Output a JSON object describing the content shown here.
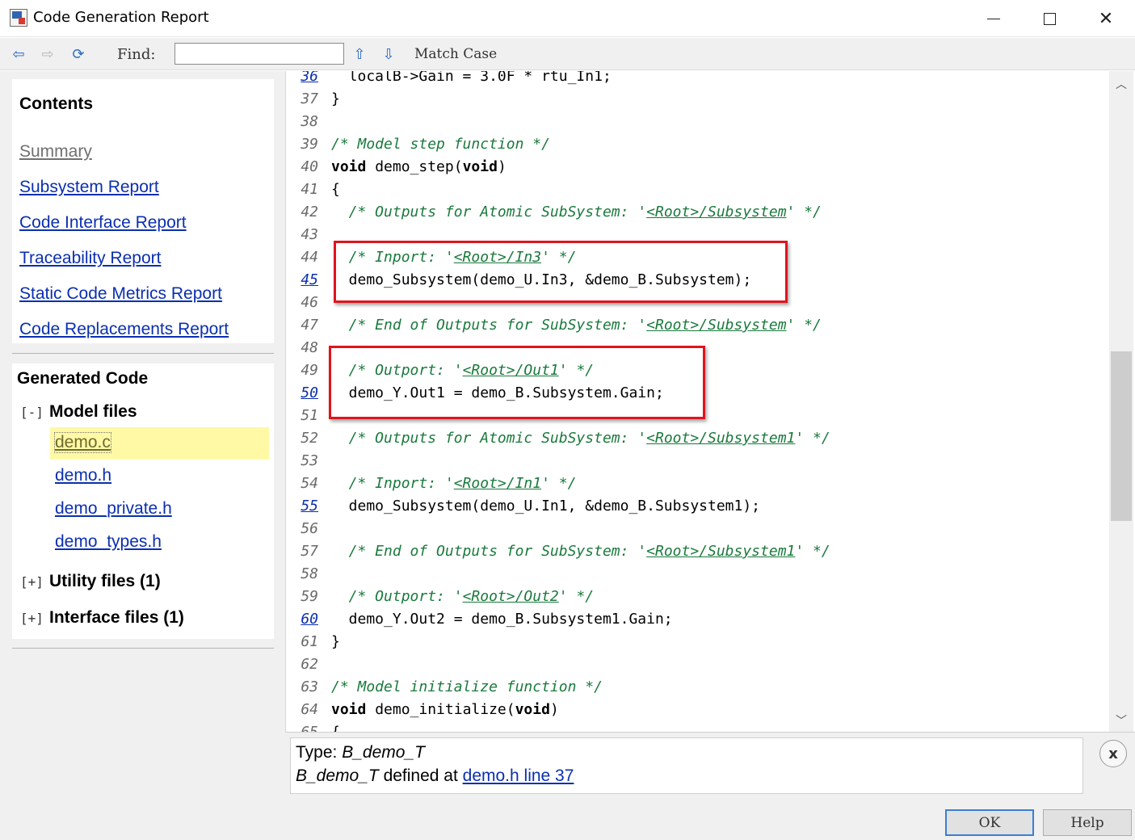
{
  "window": {
    "title": "Code Generation Report"
  },
  "toolbar": {
    "find_label": "Find:",
    "find_value": "",
    "match_case_label": "Match Case"
  },
  "contents": {
    "heading": "Contents",
    "links": [
      {
        "label": "Summary",
        "visited": true
      },
      {
        "label": "Subsystem Report"
      },
      {
        "label": "Code Interface Report"
      },
      {
        "label": "Traceability Report"
      },
      {
        "label": "Static Code Metrics Report"
      },
      {
        "label": "Code Replacements Report"
      }
    ]
  },
  "generated_code": {
    "heading": "Generated Code",
    "model_files": {
      "toggle": "[-]",
      "label": "Model files",
      "files": [
        "demo.c",
        "demo.h",
        "demo_private.h",
        "demo_types.h"
      ],
      "selected": "demo.c"
    },
    "utility_files": {
      "toggle": "[+]",
      "label": "Utility files (1)"
    },
    "interface_files": {
      "toggle": "[+]",
      "label": "Interface files (1)"
    }
  },
  "code": {
    "lines": [
      {
        "n": "36",
        "link": true,
        "parts": [
          [
            "t",
            "  localB->Gain = 3.0F * rtu_In1;"
          ]
        ]
      },
      {
        "n": "37",
        "parts": [
          [
            "t",
            "}"
          ]
        ]
      },
      {
        "n": "38",
        "parts": []
      },
      {
        "n": "39",
        "parts": [
          [
            "c",
            "/* Model step function */"
          ]
        ]
      },
      {
        "n": "40",
        "parts": [
          [
            "k",
            "void"
          ],
          [
            "t",
            " demo_step("
          ],
          [
            "k",
            "void"
          ],
          [
            "t",
            ")"
          ]
        ]
      },
      {
        "n": "41",
        "parts": [
          [
            "t",
            "{"
          ]
        ]
      },
      {
        "n": "42",
        "parts": [
          [
            "c",
            "  /* Outputs for Atomic SubSystem: '"
          ],
          [
            "l",
            "<Root>/Subsystem"
          ],
          [
            "c",
            "' */"
          ]
        ]
      },
      {
        "n": "43",
        "parts": []
      },
      {
        "n": "44",
        "parts": [
          [
            "c",
            "  /* Inport: '"
          ],
          [
            "l",
            "<Root>/In3"
          ],
          [
            "c",
            "' */"
          ]
        ]
      },
      {
        "n": "45",
        "link": true,
        "parts": [
          [
            "t",
            "  demo_Subsystem(demo_U.In3, &demo_B.Subsystem);"
          ]
        ]
      },
      {
        "n": "46",
        "parts": []
      },
      {
        "n": "47",
        "parts": [
          [
            "c",
            "  /* End of Outputs for SubSystem: '"
          ],
          [
            "l",
            "<Root>/Subsystem"
          ],
          [
            "c",
            "' */"
          ]
        ]
      },
      {
        "n": "48",
        "parts": []
      },
      {
        "n": "49",
        "parts": [
          [
            "c",
            "  /* Outport: '"
          ],
          [
            "l",
            "<Root>/Out1"
          ],
          [
            "c",
            "' */"
          ]
        ]
      },
      {
        "n": "50",
        "link": true,
        "parts": [
          [
            "t",
            "  demo_Y.Out1 = demo_B.Subsystem.Gain;"
          ]
        ]
      },
      {
        "n": "51",
        "parts": []
      },
      {
        "n": "52",
        "parts": [
          [
            "c",
            "  /* Outputs for Atomic SubSystem: '"
          ],
          [
            "l",
            "<Root>/Subsystem1"
          ],
          [
            "c",
            "' */"
          ]
        ]
      },
      {
        "n": "53",
        "parts": []
      },
      {
        "n": "54",
        "parts": [
          [
            "c",
            "  /* Inport: '"
          ],
          [
            "l",
            "<Root>/In1"
          ],
          [
            "c",
            "' */"
          ]
        ]
      },
      {
        "n": "55",
        "link": true,
        "parts": [
          [
            "t",
            "  demo_Subsystem(demo_U.In1, &demo_B.Subsystem1);"
          ]
        ]
      },
      {
        "n": "56",
        "parts": []
      },
      {
        "n": "57",
        "parts": [
          [
            "c",
            "  /* End of Outputs for SubSystem: '"
          ],
          [
            "l",
            "<Root>/Subsystem1"
          ],
          [
            "c",
            "' */"
          ]
        ]
      },
      {
        "n": "58",
        "parts": []
      },
      {
        "n": "59",
        "parts": [
          [
            "c",
            "  /* Outport: '"
          ],
          [
            "l",
            "<Root>/Out2"
          ],
          [
            "c",
            "' */"
          ]
        ]
      },
      {
        "n": "60",
        "link": true,
        "parts": [
          [
            "t",
            "  demo_Y.Out2 = demo_B.Subsystem1.Gain;"
          ]
        ]
      },
      {
        "n": "61",
        "parts": [
          [
            "t",
            "}"
          ]
        ]
      },
      {
        "n": "62",
        "parts": []
      },
      {
        "n": "63",
        "parts": [
          [
            "c",
            "/* Model initialize function */"
          ]
        ]
      },
      {
        "n": "64",
        "parts": [
          [
            "k",
            "void"
          ],
          [
            "t",
            " demo_initialize("
          ],
          [
            "k",
            "void"
          ],
          [
            "t",
            ")"
          ]
        ]
      },
      {
        "n": "65",
        "parts": [
          [
            "t",
            "{"
          ]
        ]
      }
    ]
  },
  "info": {
    "type_prefix": "Type: ",
    "type_name": "B_demo_T",
    "defined_name": "B_demo_T",
    "defined_mid": " defined at ",
    "defined_link": "demo.h line 37",
    "close_label": "x"
  },
  "buttons": {
    "ok": "OK",
    "help": "Help"
  },
  "colors": {
    "link": "#0b2fb0",
    "comment": "#1a7a3c",
    "highlight": "#fff9a6",
    "annotation": "#e0141c"
  }
}
